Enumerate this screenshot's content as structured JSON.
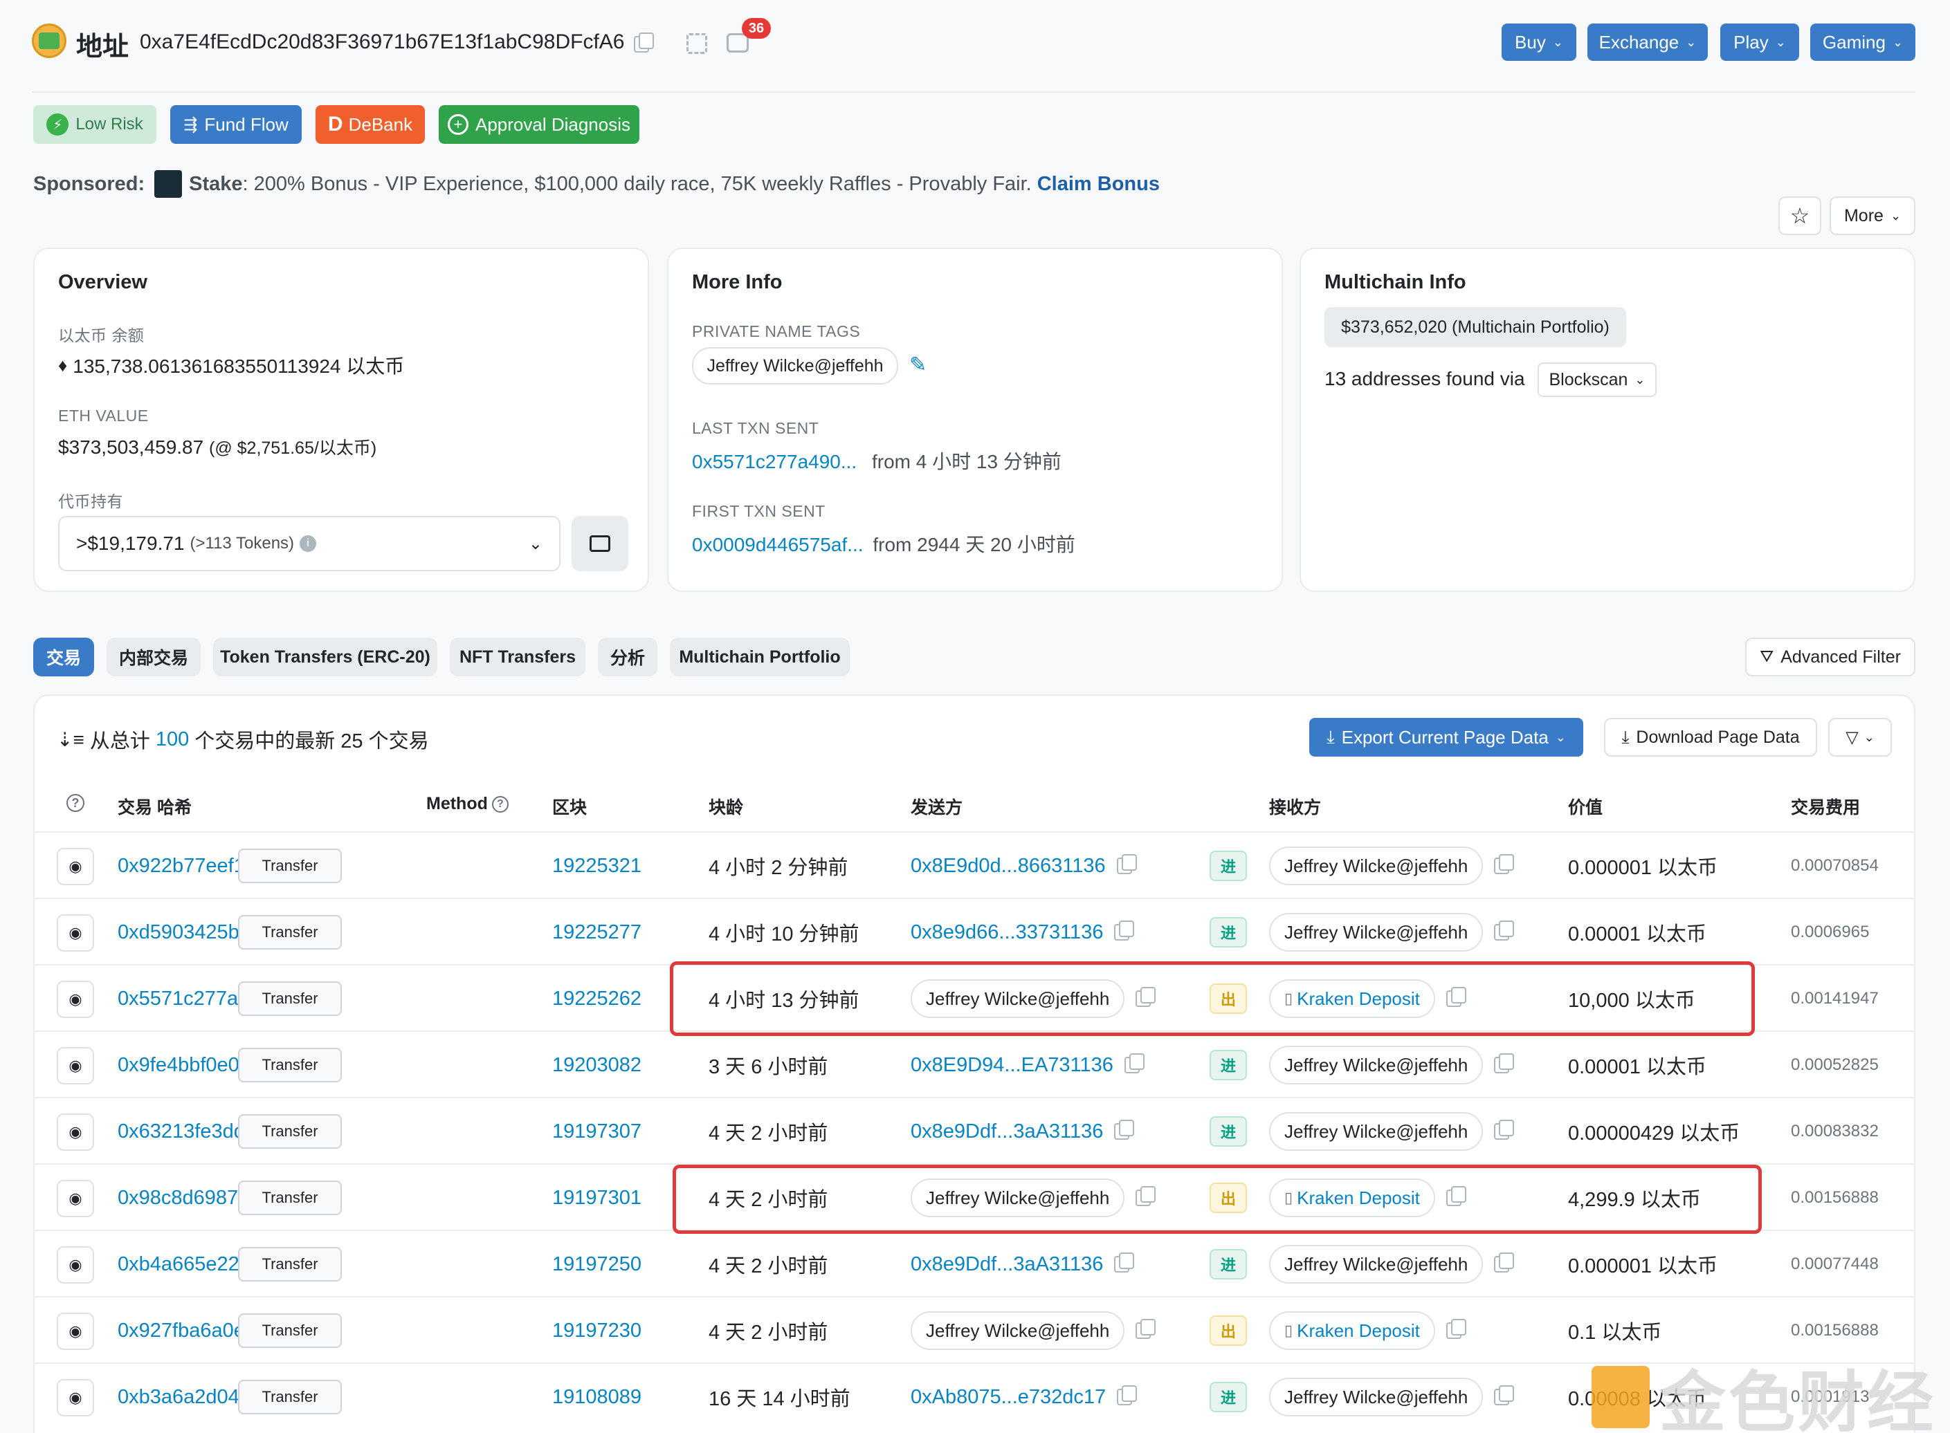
{
  "header": {
    "title": "地址",
    "address": "0xa7E4fEcdDc20d83F36971b67E13f1abC98DFcfA6",
    "notif_count": "36",
    "nav": [
      {
        "label": "Buy"
      },
      {
        "label": "Exchange"
      },
      {
        "label": "Play"
      },
      {
        "label": "Gaming"
      }
    ]
  },
  "badges": {
    "risk": "Low Risk",
    "fund_flow": "Fund Flow",
    "debank": "DeBank",
    "approval": "Approval Diagnosis"
  },
  "sponsored": {
    "label": "Sponsored:",
    "brand": "Stake",
    "text": ": 200% Bonus - VIP Experience, $100,000 daily race, 75K weekly Raffles - Provably Fair.",
    "cta": "Claim Bonus"
  },
  "actions": {
    "more": "More"
  },
  "overview": {
    "title": "Overview",
    "eth_balance_label": "以太币 余额",
    "eth_balance": "135,738.061361683550113924 以太币",
    "eth_value_label": "ETH VALUE",
    "eth_value": "$373,503,459.87",
    "eth_price": "(@ $2,751.65/以太币)",
    "token_label": "代币持有",
    "token_value": ">$19,179.71",
    "token_count": "(>113 Tokens)"
  },
  "more_info": {
    "title": "More Info",
    "private_tags_label": "PRIVATE NAME TAGS",
    "private_tag": "Jeffrey Wilcke@jeffehh",
    "last_txn_label": "LAST TXN SENT",
    "last_txn_hash": "0x5571c277a490...",
    "last_txn_time": "from 4 小时 13 分钟前",
    "first_txn_label": "FIRST TXN SENT",
    "first_txn_hash": "0x0009d446575af...",
    "first_txn_time": "from 2944 天 20 小时前"
  },
  "multichain": {
    "title": "Multichain Info",
    "portfolio": "$373,652,020 (Multichain Portfolio)",
    "addresses_text": "13 addresses found via",
    "source": "Blockscan"
  },
  "tabs": [
    {
      "label": "交易"
    },
    {
      "label": "内部交易"
    },
    {
      "label": "Token Transfers (ERC-20)"
    },
    {
      "label": "NFT Transfers"
    },
    {
      "label": "分析"
    },
    {
      "label": "Multichain Portfolio"
    }
  ],
  "advanced_filter": "Advanced Filter",
  "table": {
    "summary_prefix": "从总计",
    "summary_count": "100",
    "summary_suffix": "个交易中的最新 25 个交易",
    "export_label": "Export Current Page Data",
    "download_label": "Download Page Data",
    "headers": {
      "hash": "交易 哈希",
      "method": "Method",
      "block": "区块",
      "age": "块龄",
      "from": "发送方",
      "to": "接收方",
      "value": "价值",
      "fee": "交易费用"
    },
    "rows": [
      {
        "hash": "0x922b77eef142fbe...",
        "method": "Transfer",
        "block": "19225321",
        "age": "4 小时 2 分钟前",
        "from": "0x8E9d0d...86631136",
        "dir": "进",
        "to": "Jeffrey Wilcke@jeffehh",
        "value": "0.000001 以太币",
        "fee": "0.00070854"
      },
      {
        "hash": "0xd5903425b0d0c1...",
        "method": "Transfer",
        "block": "19225277",
        "age": "4 小时 10 分钟前",
        "from": "0x8e9d66...33731136",
        "dir": "进",
        "to": "Jeffrey Wilcke@jeffehh",
        "value": "0.00001 以太币",
        "fee": "0.0006965"
      },
      {
        "hash": "0x5571c277a4900a...",
        "method": "Transfer",
        "block": "19225262",
        "age": "4 小时 13 分钟前",
        "from": "Jeffrey Wilcke@jeffehh",
        "dir": "出",
        "to": "Kraken Deposit",
        "value": "10,000 以太币",
        "fee": "0.00141947"
      },
      {
        "hash": "0x9fe4bbf0e030bc6...",
        "method": "Transfer",
        "block": "19203082",
        "age": "3 天 6 小时前",
        "from": "0x8E9D94...EA731136",
        "dir": "进",
        "to": "Jeffrey Wilcke@jeffehh",
        "value": "0.00001 以太币",
        "fee": "0.00052825"
      },
      {
        "hash": "0x63213fe3dd11ad...",
        "method": "Transfer",
        "block": "19197307",
        "age": "4 天 2 小时前",
        "from": "0x8e9Ddf...3aA31136",
        "dir": "进",
        "to": "Jeffrey Wilcke@jeffehh",
        "value": "0.00000429 以太币",
        "fee": "0.00083832"
      },
      {
        "hash": "0x98c8d6987e3493...",
        "method": "Transfer",
        "block": "19197301",
        "age": "4 天 2 小时前",
        "from": "Jeffrey Wilcke@jeffehh",
        "dir": "出",
        "to": "Kraken Deposit",
        "value": "4,299.9 以太币",
        "fee": "0.00156888"
      },
      {
        "hash": "0xb4a665e22efe17...",
        "method": "Transfer",
        "block": "19197250",
        "age": "4 天 2 小时前",
        "from": "0x8e9Ddf...3aA31136",
        "dir": "进",
        "to": "Jeffrey Wilcke@jeffehh",
        "value": "0.000001 以太币",
        "fee": "0.00077448"
      },
      {
        "hash": "0x927fba6a0e651d...",
        "method": "Transfer",
        "block": "19197230",
        "age": "4 天 2 小时前",
        "from": "Jeffrey Wilcke@jeffehh",
        "dir": "出",
        "to": "Kraken Deposit",
        "value": "0.1 以太币",
        "fee": "0.00156888"
      },
      {
        "hash": "0xb3a6a2d04666a2...",
        "method": "Transfer",
        "block": "19108089",
        "age": "16 天 14 小时前",
        "from": "0xAb8075...e732dc17",
        "dir": "进",
        "to": "Jeffrey Wilcke@jeffehh",
        "value": "0.00008 以太币",
        "fee": "0.0001913"
      }
    ]
  },
  "watermark": "金色财经"
}
